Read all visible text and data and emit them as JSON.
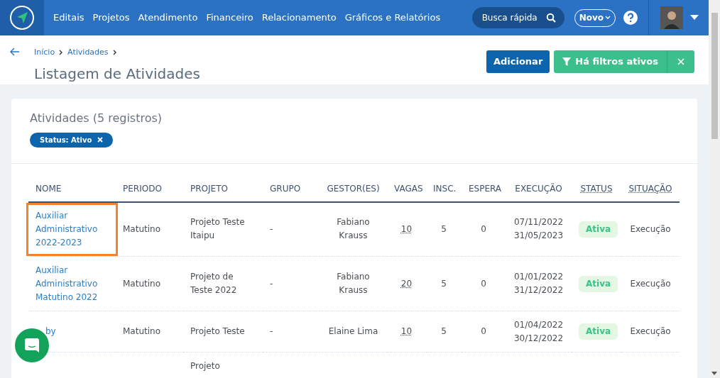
{
  "nav": {
    "items": [
      "Editais",
      "Projetos",
      "Atendimento",
      "Financeiro",
      "Relacionamento",
      "Gráficos e Relatórios"
    ],
    "search": {
      "placeholder": "Busca rápida"
    },
    "new_button": "Novo"
  },
  "breadcrumb": [
    "Início",
    "Atividades"
  ],
  "page_title": "Listagem de Atividades",
  "actions": {
    "add": "Adicionar",
    "filters": "Há filtros ativos"
  },
  "card": {
    "title": "Atividades (5 registros)",
    "filter_tags": [
      "Status: Ativo"
    ]
  },
  "table": {
    "columns": [
      {
        "label": "NOME",
        "dotted": false
      },
      {
        "label": "PERIODO",
        "dotted": false
      },
      {
        "label": "PROJETO",
        "dotted": false
      },
      {
        "label": "GRUPO",
        "dotted": false
      },
      {
        "label": "GESTOR(ES)",
        "dotted": false
      },
      {
        "label": "VAGAS",
        "dotted": false
      },
      {
        "label": "INSC.",
        "dotted": false
      },
      {
        "label": "ESPERA",
        "dotted": false
      },
      {
        "label": "EXECUÇÃO",
        "dotted": false
      },
      {
        "label": "STATUS",
        "dotted": true
      },
      {
        "label": "SITUAÇÃO",
        "dotted": true
      }
    ],
    "rows": [
      {
        "name": "Auxiliar Administrativo 2022-2023",
        "highlighted": true,
        "covered": false,
        "periodo": "Matutino",
        "projeto": "Projeto Teste Itaipu",
        "grupo": "-",
        "gestor": "Fabiano Krauss",
        "vagas": "10",
        "insc": "5",
        "espera": "0",
        "execucao": [
          "07/11/2022",
          "31/05/2023"
        ],
        "status": "Ativa",
        "situacao": "Execução"
      },
      {
        "name": "Auxiliar Administrativo Matutino 2022",
        "highlighted": false,
        "covered": false,
        "periodo": "Matutino",
        "projeto": "Projeto de Teste 2022",
        "grupo": "-",
        "gestor": "Fabiano Krauss",
        "vagas": "20",
        "insc": "5",
        "espera": "0",
        "execucao": [
          "01/01/2022",
          "31/12/2022"
        ],
        "status": "Ativa",
        "situacao": "Execução"
      },
      {
        "name": "by",
        "highlighted": false,
        "covered": true,
        "periodo": "Matutino",
        "projeto": "Projeto Teste",
        "grupo": "-",
        "gestor": "Elaine Lima",
        "vagas": "10",
        "insc": "5",
        "espera": "0",
        "execucao": [
          "01/04/2022",
          "30/12/2022"
        ],
        "status": "Ativa",
        "situacao": "Execução"
      },
      {
        "projeto": "Projeto"
      }
    ]
  }
}
